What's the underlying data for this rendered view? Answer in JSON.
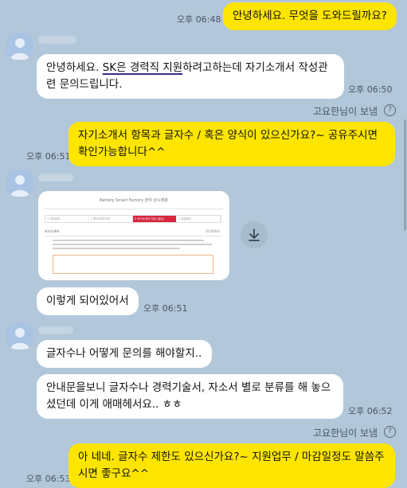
{
  "messages": {
    "m1": {
      "text": "안녕하세요. 무엇을 도와드릴까요?",
      "time": "오후 06:48"
    },
    "m2": {
      "line1_pre": "안녕하세요. ",
      "line1_underlined": "SK은 경력직 지원",
      "line1_post": "하려고하는데 자기소개서 작성관",
      "line2": "련 문의드립니다.",
      "time": "오후 06:50"
    },
    "notice1": "고요한님이 보냄",
    "m3": {
      "line1": "자기소개서 항목과 글자수 / 혹은 양식이 있으신가요?~ 공유주시면",
      "line2": "확인가능합니다^^",
      "time": "오후 06:51"
    },
    "m4": {
      "image": {
        "title": "Battery Smart Factory 분야 상시채용",
        "steps": [
          "1 개인정보",
          "2 학력/경력사항",
          "3 자기소개서 작성 (필수)",
          "4 최종확인"
        ],
        "field_label": "자기소개서",
        "field_counter": "0/2000자"
      },
      "text": "이렇게 되어있어서",
      "time": "오후 06:51"
    },
    "m5": {
      "text": "글자수나 어떻게 문의를 해야할지..",
      "line1": "안내문을보니 글자수나 경력기술서, 자소서 별로 분류를 해 놓으",
      "line2": "셨던데 이게 애매헤서요.. ㅎㅎ",
      "time": "오후 06:52"
    },
    "notice2": "고요한님이 보냄",
    "m6": {
      "line1": "아 네네. 글자수 제한도 있으신가요?~ 지원업무 / 마감일정도 말씀주",
      "line2": "시면 좋구요^^",
      "time": "오후 06:53"
    }
  },
  "icons": {
    "avatar": "person-avatar-icon",
    "download": "download-icon",
    "help": "question-circle-icon"
  },
  "colors": {
    "background": "#b2c7d9",
    "mine": "#fee500",
    "theirs": "#ffffff"
  }
}
